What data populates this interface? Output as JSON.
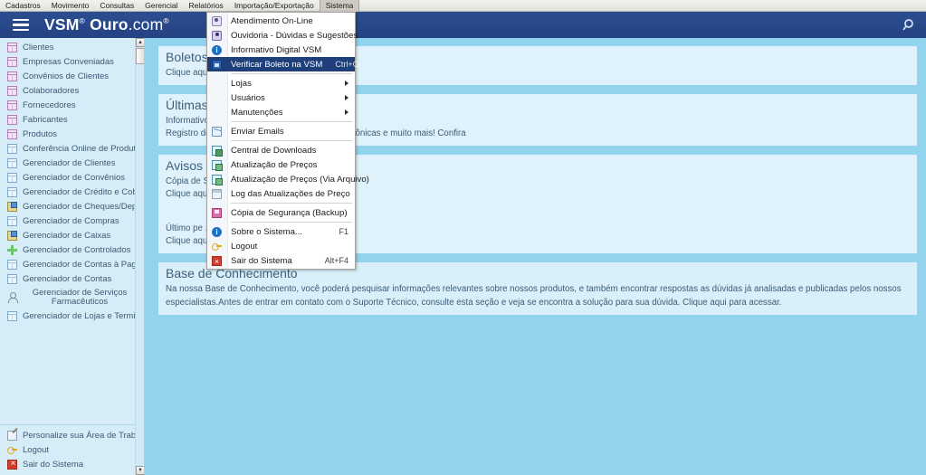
{
  "osmenu": {
    "items": [
      {
        "label": "Cadastros",
        "active": false
      },
      {
        "label": "Movimento",
        "active": false
      },
      {
        "label": "Consultas",
        "active": false
      },
      {
        "label": "Gerencial",
        "active": false
      },
      {
        "label": "Relatórios",
        "active": false
      },
      {
        "label": "Importação/Exportação",
        "active": false
      },
      {
        "label": "Sistema",
        "active": true
      }
    ]
  },
  "header": {
    "brand_vsm": "VSM",
    "brand_sup1": "®",
    "brand_ouro": "Ouro",
    "brand_com": ".com",
    "brand_sup2": "®",
    "menu_icon": "hamburger-icon",
    "search_icon": "search-icon"
  },
  "sidebar": {
    "items": [
      {
        "label": "Clientes",
        "icon": "grid-pink"
      },
      {
        "label": "Empresas Conveniadas",
        "icon": "grid-pink"
      },
      {
        "label": "Convênios de Clientes",
        "icon": "grid-pink"
      },
      {
        "label": "Colaboradores",
        "icon": "grid-pink"
      },
      {
        "label": "Fornecedores",
        "icon": "grid-pink"
      },
      {
        "label": "Fabricantes",
        "icon": "grid-pink"
      },
      {
        "label": "Produtos",
        "icon": "grid-pink"
      },
      {
        "label": "Conferência Online de Produtos",
        "icon": "grid-blue"
      },
      {
        "label": "Gerenciador de Clientes",
        "icon": "grid-blue"
      },
      {
        "label": "Gerenciador de Convênios",
        "icon": "grid-blue"
      },
      {
        "label": "Gerenciador de Crédito e Cobrança",
        "icon": "grid-blue"
      },
      {
        "label": "Gerenciador de Cheques/Depósitos",
        "icon": "money"
      },
      {
        "label": "Gerenciador de Compras",
        "icon": "grid-blue"
      },
      {
        "label": "Gerenciador de Caixas",
        "icon": "money"
      },
      {
        "label": "Gerenciador de Controlados",
        "icon": "cross"
      },
      {
        "label": "Gerenciador de Contas à Pagar",
        "icon": "grid-blue"
      },
      {
        "label": "Gerenciador de Contas",
        "icon": "grid-blue"
      },
      {
        "label": "Gerenciador de Serviços Farmacêuticos",
        "icon": "person",
        "two_line": true
      },
      {
        "label": "Gerenciador de Lojas e Terminais",
        "icon": "grid-blue"
      }
    ],
    "footer": [
      {
        "label": "Personalize sua Área de Trabalho",
        "icon": "pencil"
      },
      {
        "label": "Logout",
        "icon": "key"
      },
      {
        "label": "Sair do Sistema",
        "icon": "exitred"
      }
    ],
    "scrollbar": {
      "up_glyph": "▲",
      "down_glyph": "▼"
    }
  },
  "main": {
    "panels": [
      {
        "title": "Boletos",
        "rows": [
          "Clique aqui"
        ]
      },
      {
        "title": "Últimas",
        "rows": [
          "Informativo",
          "Registro de ... na emissão de Notas Fiscais Eletrônicas e muito mais! Confira"
        ]
      },
      {
        "title": "Avisos",
        "rows": [
          "Cópia de S",
          "Clique aqui",
          "Último pe ... 7/10/2008",
          "Clique aqui ... ntrolados."
        ]
      }
    ],
    "knowledge": {
      "title": "Base de Conhecimento",
      "text": "Na nossa Base de Conhecimento, você poderá pesquisar informações relevantes sobre nossos produtos, e também encontrar respostas as dúvidas já analisadas e publicadas pelos nossos especialistas.Antes de entrar em contato com o Suporte Técnico, consulte esta seção e veja se encontra a solução para sua dúvida. Clique aqui para acessar."
    }
  },
  "dropdown": {
    "items": [
      {
        "label": "Atendimento On-Line",
        "icon": "people",
        "accel": "",
        "submenu": false,
        "selected": false,
        "sep_after": false
      },
      {
        "label": "Ouvidoria - Dúvidas e Sugestões",
        "icon": "people2",
        "accel": "",
        "submenu": false,
        "selected": false,
        "sep_after": false
      },
      {
        "label": "Informativo Digital VSM",
        "icon": "info",
        "accel": "",
        "submenu": false,
        "selected": false,
        "sep_after": false
      },
      {
        "label": "Verificar Boleto na VSM",
        "icon": "winblue",
        "accel": "Ctrl+O",
        "submenu": false,
        "selected": true,
        "sep_after": true
      },
      {
        "label": "Lojas",
        "icon": "",
        "accel": "",
        "submenu": true,
        "selected": false,
        "sep_after": false
      },
      {
        "label": "Usuários",
        "icon": "",
        "accel": "",
        "submenu": true,
        "selected": false,
        "sep_after": false
      },
      {
        "label": "Manutenções",
        "icon": "",
        "accel": "",
        "submenu": true,
        "selected": false,
        "sep_after": true
      },
      {
        "label": "Enviar Emails",
        "icon": "mail",
        "accel": "",
        "submenu": false,
        "selected": false,
        "sep_after": true
      },
      {
        "label": "Central de Downloads",
        "icon": "dl",
        "accel": "",
        "submenu": false,
        "selected": false,
        "sep_after": false
      },
      {
        "label": "Atualização de Preços",
        "icon": "dl2",
        "accel": "",
        "submenu": false,
        "selected": false,
        "sep_after": false
      },
      {
        "label": "Atualização de Preços (Via Arquivo)",
        "icon": "dl2",
        "accel": "",
        "submenu": false,
        "selected": false,
        "sep_after": false
      },
      {
        "label": "Log das Atualizações de Preço",
        "icon": "winlog",
        "accel": "",
        "submenu": false,
        "selected": false,
        "sep_after": true
      },
      {
        "label": "Cópia de Segurança (Backup)",
        "icon": "save",
        "accel": "",
        "submenu": false,
        "selected": false,
        "sep_after": true
      },
      {
        "label": "Sobre o Sistema...",
        "icon": "info",
        "accel": "F1",
        "submenu": false,
        "selected": false,
        "sep_after": false
      },
      {
        "label": "Logout",
        "icon": "key2",
        "accel": "",
        "submenu": false,
        "selected": false,
        "sep_after": false
      },
      {
        "label": "Sair do Sistema",
        "icon": "exit",
        "accel": "Alt+F4",
        "submenu": false,
        "selected": false,
        "sep_after": false
      }
    ]
  },
  "colors": {
    "header_blue": "#2b4e8f",
    "content_bg": "#92d3ee",
    "sidebar_bg": "#d6edf8",
    "panel_bg": "#dff1fa",
    "menu_highlight": "#1e3f7a"
  }
}
